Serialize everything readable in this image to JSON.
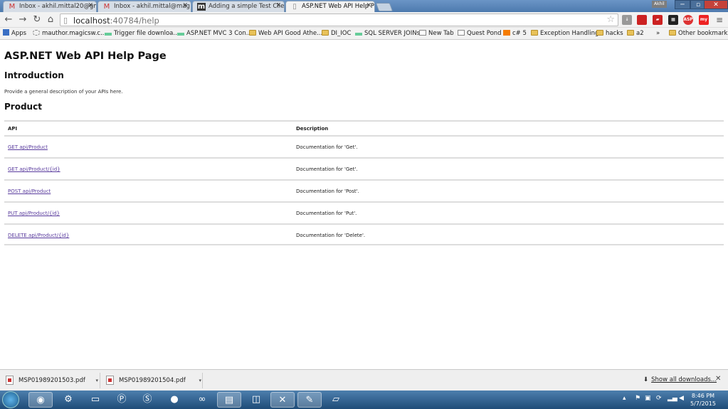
{
  "browser": {
    "tabs": [
      {
        "label": "Inbox - akhil.mittal20@gm",
        "icon": "gmail-icon"
      },
      {
        "label": "Inbox - akhil.mittal@mag",
        "icon": "gmail-icon"
      },
      {
        "label": "Adding a simple Test Clie",
        "icon": "m-icon"
      },
      {
        "label": "ASP.NET Web API Help Pa",
        "icon": "page-icon"
      }
    ],
    "user": "Akhil",
    "url_host": "localhost",
    "url_rest": ":40784/help",
    "extensions": [
      "ASP",
      "my"
    ],
    "bookmarks": [
      {
        "label": "Apps",
        "icon": "apps-icon"
      },
      {
        "label": "mauthor.magicsw.c...",
        "icon": "loading-icon"
      },
      {
        "label": "Trigger file downloa...",
        "icon": "link-icon"
      },
      {
        "label": "ASP.NET MVC 3 Con...",
        "icon": "link-icon"
      },
      {
        "label": "Web API Good Athe...",
        "icon": "folder-icon"
      },
      {
        "label": "DI_IOC",
        "icon": "folder-icon"
      },
      {
        "label": "SQL SERVER JOINs",
        "icon": "link-icon"
      },
      {
        "label": "New Tab",
        "icon": "page-icon"
      },
      {
        "label": "Quest Pond",
        "icon": "page-icon"
      },
      {
        "label": "c# 5",
        "icon": "blogger-icon"
      },
      {
        "label": "Exception Handling",
        "icon": "folder-icon"
      },
      {
        "label": "hacks",
        "icon": "folder-icon"
      },
      {
        "label": "a2",
        "icon": "folder-icon"
      },
      {
        "label": "»",
        "icon": "chevron-icon"
      },
      {
        "label": "Other bookmarks",
        "icon": "folder-icon"
      }
    ]
  },
  "page": {
    "title": "ASP.NET Web API Help Page",
    "intro_heading": "Introduction",
    "intro_text": "Provide a general description of your APIs here.",
    "section_heading": "Product",
    "table": {
      "headers": {
        "api": "API",
        "description": "Description"
      },
      "rows": [
        {
          "api": "GET api/Product",
          "description": "Documentation for 'Get'."
        },
        {
          "api": "GET api/Product/{id}",
          "description": "Documentation for 'Get'."
        },
        {
          "api": "POST api/Product",
          "description": "Documentation for 'Post'."
        },
        {
          "api": "PUT api/Product/{id}",
          "description": "Documentation for 'Put'."
        },
        {
          "api": "DELETE api/Product/{id}",
          "description": "Documentation for 'Delete'."
        }
      ]
    }
  },
  "downloads": {
    "items": [
      "MSP01989201503.pdf",
      "MSP01989201504.pdf"
    ],
    "show_all": "Show all downloads..."
  },
  "taskbar": {
    "time": "8:46 PM",
    "date": "5/7/2015"
  },
  "colors": {
    "link": "#5a3c9e",
    "tabstrip": "#5b86b8",
    "taskbar": "#2b5f8f"
  }
}
